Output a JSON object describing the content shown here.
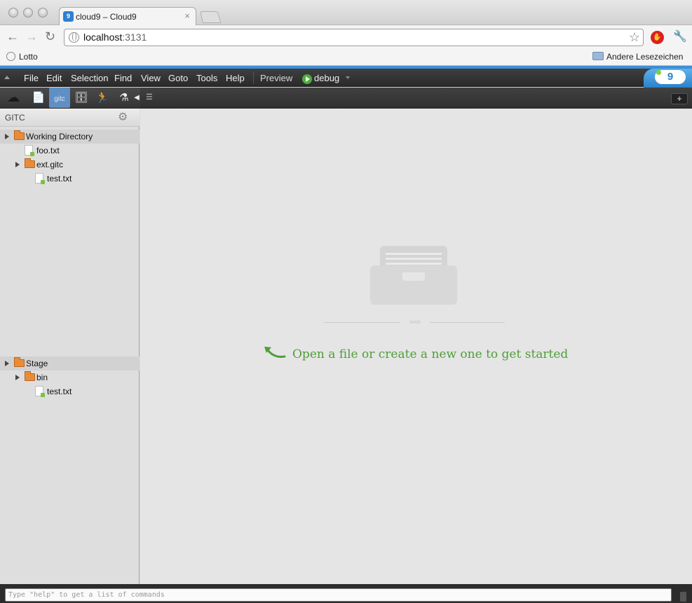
{
  "browser": {
    "tab_title": "cloud9 – Cloud9",
    "tab_close": "×",
    "favicon_text": "9",
    "url_host": "localhost",
    "url_port": ":3131",
    "bookmarks": [
      {
        "label": "Lotto"
      }
    ],
    "other_bookmarks": "Andere Lesezeichen"
  },
  "menubar": {
    "items": [
      "File",
      "Edit",
      "Selection",
      "Find",
      "View",
      "Goto",
      "Tools",
      "Help"
    ],
    "preview": "Preview",
    "run_config": "debug",
    "logo_text": "9"
  },
  "iconbar": {
    "active_label": "gitc"
  },
  "sidebar": {
    "panel_title": "GITC",
    "working_directory": {
      "label": "Working Directory",
      "children": [
        {
          "label": "foo.txt"
        },
        {
          "label": "ext.gitc"
        },
        {
          "label": "test.txt"
        }
      ]
    },
    "stage": {
      "label": "Stage",
      "children": [
        {
          "label": "bin"
        },
        {
          "label": "test.txt"
        }
      ]
    }
  },
  "editor": {
    "empty_message": "Open a file or create a new one to get started",
    "new_tab": "+"
  },
  "cmdline": {
    "placeholder": "Type \"help\" to get a list of commands"
  },
  "colors": {
    "accent": "#3c8fd6",
    "hint_green": "#4f9e38",
    "folder_orange": "#e98c3a"
  }
}
